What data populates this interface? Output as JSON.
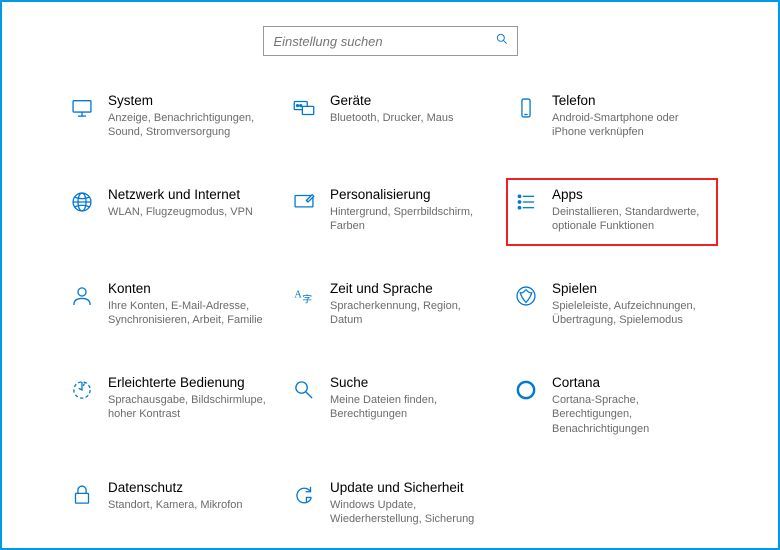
{
  "search": {
    "placeholder": "Einstellung suchen"
  },
  "tiles": [
    {
      "id": "system",
      "title": "System",
      "desc": "Anzeige, Benachrichtigungen, Sound, Stromversorgung"
    },
    {
      "id": "devices",
      "title": "Geräte",
      "desc": "Bluetooth, Drucker, Maus"
    },
    {
      "id": "phone",
      "title": "Telefon",
      "desc": "Android-Smartphone oder iPhone verknüpfen"
    },
    {
      "id": "network",
      "title": "Netzwerk und Internet",
      "desc": "WLAN, Flugzeugmodus, VPN"
    },
    {
      "id": "personalization",
      "title": "Personalisierung",
      "desc": "Hintergrund, Sperrbildschirm, Farben"
    },
    {
      "id": "apps",
      "title": "Apps",
      "desc": "Deinstallieren, Standardwerte, optionale Funktionen",
      "highlight": true
    },
    {
      "id": "accounts",
      "title": "Konten",
      "desc": "Ihre Konten, E-Mail-Adresse, Synchronisieren, Arbeit, Familie"
    },
    {
      "id": "time",
      "title": "Zeit und Sprache",
      "desc": "Spracherkennung, Region, Datum"
    },
    {
      "id": "gaming",
      "title": "Spielen",
      "desc": "Spieleleiste, Aufzeichnungen, Übertragung, Spielemodus"
    },
    {
      "id": "ease",
      "title": "Erleichterte Bedienung",
      "desc": "Sprachausgabe, Bildschirmlupe, hoher Kontrast"
    },
    {
      "id": "search",
      "title": "Suche",
      "desc": "Meine Dateien finden, Berechtigungen"
    },
    {
      "id": "cortana",
      "title": "Cortana",
      "desc": "Cortana-Sprache, Berechtigungen, Benachrichtigungen"
    },
    {
      "id": "privacy",
      "title": "Datenschutz",
      "desc": "Standort, Kamera, Mikrofon"
    },
    {
      "id": "update",
      "title": "Update und Sicherheit",
      "desc": "Windows Update, Wiederherstellung, Sicherung"
    }
  ],
  "colors": {
    "accent": "#0078d4",
    "highlight_border": "#e22"
  }
}
